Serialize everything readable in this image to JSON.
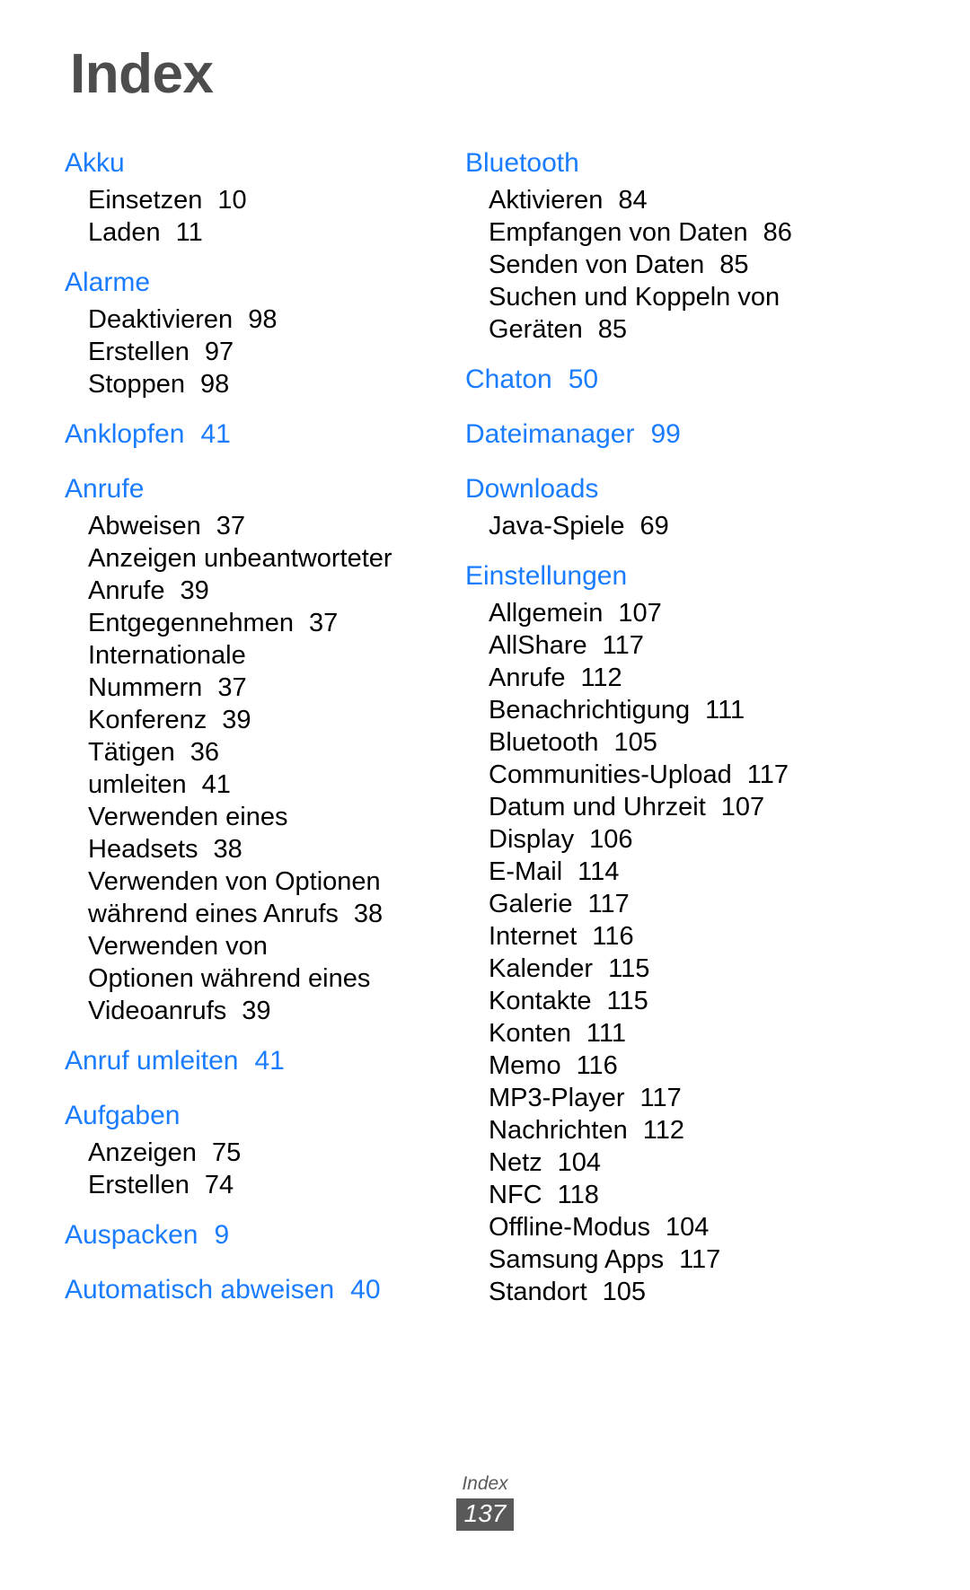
{
  "page": {
    "title": "Index",
    "footer_label": "Index",
    "footer_page_number": "137",
    "heading_color": "#1a7cff",
    "title_color": "#4d4d4d",
    "footer_box_color": "#595959"
  },
  "columns": [
    {
      "name": "left",
      "groups": [
        {
          "heading": "Akku",
          "heading_page": "",
          "entries": [
            {
              "label": "Einsetzen",
              "page": "10"
            },
            {
              "label": "Laden",
              "page": "11"
            }
          ]
        },
        {
          "heading": "Alarme",
          "heading_page": "",
          "entries": [
            {
              "label": "Deaktivieren",
              "page": "98"
            },
            {
              "label": "Erstellen",
              "page": "97"
            },
            {
              "label": "Stoppen",
              "page": "98"
            }
          ]
        },
        {
          "heading": "Anklopfen",
          "heading_page": "41",
          "entries": []
        },
        {
          "heading": "Anrufe",
          "heading_page": "",
          "entries": [
            {
              "label": "Abweisen",
              "page": "37"
            },
            {
              "label": "Anzeigen unbeantworteter",
              "page": ""
            },
            {
              "label": "Anrufe",
              "page": "39"
            },
            {
              "label": "Entgegennehmen",
              "page": "37"
            },
            {
              "label": "Internationale",
              "page": ""
            },
            {
              "label": "Nummern",
              "page": "37"
            },
            {
              "label": "Konferenz",
              "page": "39"
            },
            {
              "label": "Tätigen",
              "page": "36"
            },
            {
              "label": "umleiten",
              "page": "41"
            },
            {
              "label": "Verwenden eines",
              "page": ""
            },
            {
              "label": "Headsets",
              "page": "38"
            },
            {
              "label": "Verwenden von Optionen",
              "page": ""
            },
            {
              "label": "während eines Anrufs",
              "page": "38"
            },
            {
              "label": "Verwenden von",
              "page": ""
            },
            {
              "label": "Optionen während eines",
              "page": ""
            },
            {
              "label": "Videoanrufs",
              "page": "39"
            }
          ]
        },
        {
          "heading": "Anruf umleiten",
          "heading_page": "41",
          "entries": []
        },
        {
          "heading": "Aufgaben",
          "heading_page": "",
          "entries": [
            {
              "label": "Anzeigen",
              "page": "75"
            },
            {
              "label": "Erstellen",
              "page": "74"
            }
          ]
        },
        {
          "heading": "Auspacken",
          "heading_page": "9",
          "entries": []
        },
        {
          "heading": "Automatisch abweisen",
          "heading_page": "40",
          "entries": []
        }
      ]
    },
    {
      "name": "right",
      "groups": [
        {
          "heading": "Bluetooth",
          "heading_page": "",
          "entries": [
            {
              "label": "Aktivieren",
              "page": "84"
            },
            {
              "label": "Empfangen von Daten",
              "page": "86"
            },
            {
              "label": "Senden von Daten",
              "page": "85"
            },
            {
              "label": "Suchen und Koppeln von",
              "page": ""
            },
            {
              "label": "Geräten",
              "page": "85"
            }
          ]
        },
        {
          "heading": "Chaton",
          "heading_page": "50",
          "entries": []
        },
        {
          "heading": "Dateimanager",
          "heading_page": "99",
          "entries": []
        },
        {
          "heading": "Downloads",
          "heading_page": "",
          "entries": [
            {
              "label": "Java-Spiele",
              "page": "69"
            }
          ]
        },
        {
          "heading": "Einstellungen",
          "heading_page": "",
          "entries": [
            {
              "label": "Allgemein",
              "page": "107"
            },
            {
              "label": "AllShare",
              "page": "117"
            },
            {
              "label": "Anrufe",
              "page": "112"
            },
            {
              "label": "Benachrichtigung",
              "page": "111"
            },
            {
              "label": "Bluetooth",
              "page": "105"
            },
            {
              "label": "Communities-Upload",
              "page": "117"
            },
            {
              "label": "Datum und Uhrzeit",
              "page": "107"
            },
            {
              "label": "Display",
              "page": "106"
            },
            {
              "label": "E-Mail",
              "page": "114"
            },
            {
              "label": "Galerie",
              "page": "117"
            },
            {
              "label": "Internet",
              "page": "116"
            },
            {
              "label": "Kalender",
              "page": "115"
            },
            {
              "label": "Kontakte",
              "page": "115"
            },
            {
              "label": "Konten",
              "page": "111"
            },
            {
              "label": "Memo",
              "page": "116"
            },
            {
              "label": "MP3-Player",
              "page": "117"
            },
            {
              "label": "Nachrichten",
              "page": "112"
            },
            {
              "label": "Netz",
              "page": "104"
            },
            {
              "label": "NFC",
              "page": "118"
            },
            {
              "label": "Offline-Modus",
              "page": "104"
            },
            {
              "label": "Samsung Apps",
              "page": "117"
            },
            {
              "label": "Standort",
              "page": "105"
            }
          ]
        }
      ]
    }
  ]
}
